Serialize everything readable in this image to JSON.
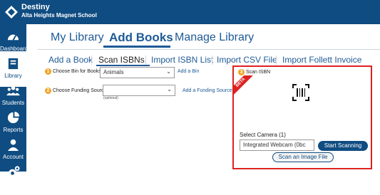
{
  "app": {
    "name": "Destiny",
    "school": "Alta Heights Magnet School"
  },
  "sidebar": {
    "items": [
      {
        "label": "Dashboard",
        "icon": "dashboard-icon"
      },
      {
        "label": "Library",
        "icon": "library-icon",
        "active": true
      },
      {
        "label": "Students",
        "icon": "students-icon"
      },
      {
        "label": "Reports",
        "icon": "reports-icon"
      },
      {
        "label": "Account",
        "icon": "account-icon"
      },
      {
        "label": "",
        "icon": "settings-icon"
      }
    ]
  },
  "primary_tabs": [
    "My Library",
    "Add Books",
    "Manage Library"
  ],
  "secondary_tabs": [
    "Add a Book",
    "Scan ISBNs",
    "Import ISBN List",
    "Import CSV File",
    "Import Follett Invoice"
  ],
  "form": {
    "bin": {
      "step": "1",
      "label": "Choose Bin for Books",
      "value": "Animals",
      "link": "Add a Bin"
    },
    "funding": {
      "step": "2",
      "label": "Choose Funding Source",
      "value": "",
      "hint": "(optional)",
      "link": "Add a Funding Source"
    }
  },
  "scanner": {
    "step": "3",
    "title": "Scan ISBN",
    "beta": "BETA",
    "camera_label": "Select Camera (1)",
    "camera_value": "Integrated Webcam (0bc",
    "start_button": "Start Scanning",
    "image_button": "Scan an Image File"
  },
  "colors": {
    "brand": "#0f4c81",
    "link": "#1e5a96",
    "badge": "#f0a323",
    "alert": "#d22222"
  }
}
